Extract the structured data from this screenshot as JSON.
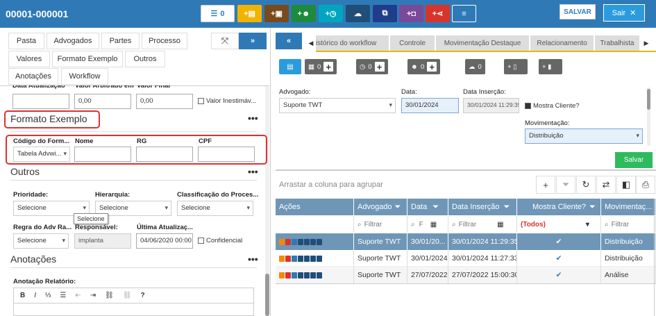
{
  "header": {
    "title": "00001-000001",
    "count": "0",
    "save_label": "SALVAR",
    "exit_label": "Sair"
  },
  "toolbar_colors": [
    "#ffffff",
    "#f0b400",
    "#7a4a1c",
    "#1e8a3c",
    "#00a6c0",
    "#1f4e79",
    "#1f3d8a",
    "#7a4a9a",
    "#d9342b",
    "#2f7ab6"
  ],
  "left": {
    "tabs": [
      "Pasta",
      "Advogados",
      "Partes",
      "Processo",
      "Valores",
      "Formato Exemplo",
      "Outros",
      "Anotações",
      "Workflow"
    ],
    "partial_labels": [
      "Data Atualização",
      "Valor Arbitrado em",
      "Valor Final"
    ],
    "values_row": {
      "v1": "",
      "v2": "0,00",
      "v3": "0,00",
      "checkbox": "Valor Inestimáv..."
    },
    "formato": {
      "title": "Formato Exemplo",
      "labels": [
        "Código do Form...",
        "Nome",
        "RG",
        "CPF"
      ],
      "code_value": "Tabela Advwi..."
    },
    "outros": {
      "title": "Outros",
      "labels": [
        "Prioridade:",
        "Hierarquia:",
        "Classificação do Proces...",
        "Regra do Adv Ra...",
        "Responsável:",
        "Última Atualizaç..."
      ],
      "prioridade": "Selecione",
      "hierarquia": "Selecione",
      "classificacao": "Selecione",
      "tooltip": "Selecione",
      "regra": "Selecione",
      "responsavel": "implanta",
      "ultima": "04/06/2020 00:00",
      "confidencial": "Confidencial"
    },
    "anotacoes": {
      "title": "Anotações",
      "label": "Anotação Relatório:",
      "tools": [
        "B",
        "I",
        "⅓",
        "☰",
        "⇤",
        "⇥",
        "⛓",
        "⛓",
        "?"
      ]
    }
  },
  "right": {
    "tabs": [
      "istórico do workflow",
      "Controle",
      "Movimentação Destaque",
      "Relacionamento",
      "Trabalhista"
    ],
    "chips": [
      "0",
      "0",
      "0",
      "0",
      "0"
    ],
    "form": {
      "advogado_label": "Advogado:",
      "advogado": "Suporte TWT",
      "data_label": "Data:",
      "data": "30/01/2024",
      "insercao_label": "Data Inserção:",
      "insercao": "30/01/2024 11:29:35",
      "mostra": "Mostra Cliente?",
      "mov_label": "Movimentação:",
      "mov": "Distribuição",
      "save": "Salvar"
    },
    "grid": {
      "drag_hint": "Arrastar a coluna para agrupar",
      "headers": [
        "Ações",
        "Advogado",
        "Data",
        "Data Inserção",
        "Mostra Cliente?",
        "Movimentaç..."
      ],
      "filters": [
        "Filtrar",
        "F",
        "Filtrar",
        "(Todos)",
        "Filtrar"
      ],
      "rows": [
        {
          "advogado": "Suporte TWT",
          "data": "30/01/20...",
          "insercao": "30/01/2024 11:29:35",
          "mostra": "✔",
          "mov": "Distribuição"
        },
        {
          "advogado": "Suporte TWT",
          "data": "30/01/2024",
          "insercao": "30/01/2024 11:27:33",
          "mostra": "✔",
          "mov": "Distribuição"
        },
        {
          "advogado": "Suporte TWT",
          "data": "27/07/2022",
          "insercao": "27/07/2022 15:00:30",
          "mostra": "✔",
          "mov": "Análise"
        }
      ]
    }
  }
}
